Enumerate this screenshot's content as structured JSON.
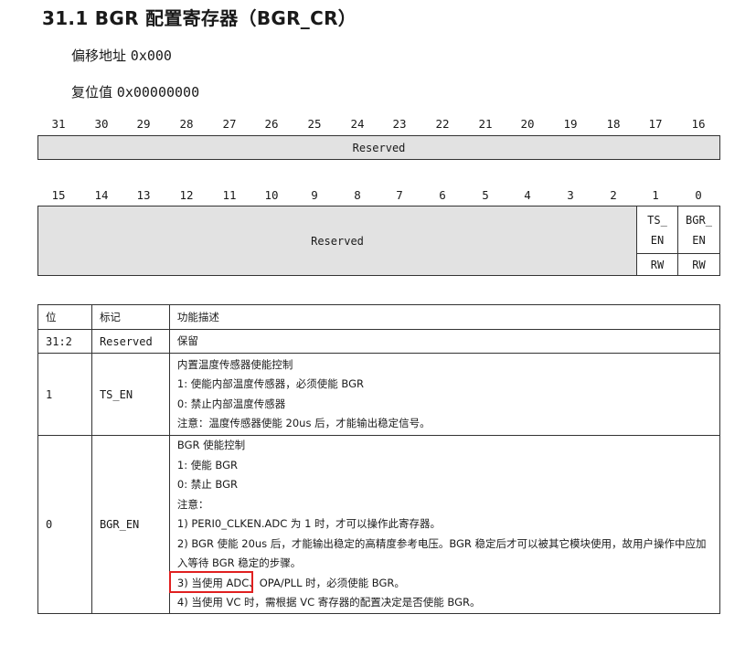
{
  "title": "31.1 BGR 配置寄存器（BGR_CR）",
  "offset_label": "偏移地址",
  "offset_value": "0x000",
  "reset_label": "复位值",
  "reset_value": "0x00000000",
  "bits_high": [
    "31",
    "30",
    "29",
    "28",
    "27",
    "26",
    "25",
    "24",
    "23",
    "22",
    "21",
    "20",
    "19",
    "18",
    "17",
    "16"
  ],
  "bits_low": [
    "15",
    "14",
    "13",
    "12",
    "11",
    "10",
    "9",
    "8",
    "7",
    "6",
    "5",
    "4",
    "3",
    "2",
    "1",
    "0"
  ],
  "reg_high": {
    "label": "Reserved"
  },
  "reg_low": {
    "reserved": "Reserved",
    "ts_en_top": "TS_",
    "ts_en_bottom": "EN",
    "ts_en_access": "RW",
    "bgr_en_top": "BGR_",
    "bgr_en_bottom": "EN",
    "bgr_en_access": "RW"
  },
  "table": {
    "headers": {
      "bit": "位",
      "mark": "标记",
      "desc": "功能描述"
    },
    "rows": [
      {
        "bit": "31:2",
        "mark": "Reserved",
        "lines": [
          "保留"
        ]
      },
      {
        "bit": "1",
        "mark": "TS_EN",
        "lines": [
          "内置温度传感器使能控制",
          "1: 使能内部温度传感器，必须使能 BGR",
          "0: 禁止内部温度传感器",
          "注意：温度传感器使能 20us 后，才能输出稳定信号。"
        ]
      },
      {
        "bit": "0",
        "mark": "BGR_EN",
        "lines": [
          "BGR 使能控制",
          "1: 使能 BGR",
          "0: 禁止 BGR",
          "注意：",
          "1) PERI0_CLKEN.ADC 为 1 时，才可以操作此寄存器。",
          "2) BGR 使能 20us 后，才能输出稳定的高精度参考电压。BGR 稳定后才可以被其它模块使用，故用户操作中应加入等待 BGR 稳定的步骤。",
          "3) 当使用 ADC、OPA/PLL 时，必须使能 BGR。",
          "4) 当使用 VC 时，需根据 VC 寄存器的配置决定是否使能 BGR。"
        ]
      }
    ]
  }
}
